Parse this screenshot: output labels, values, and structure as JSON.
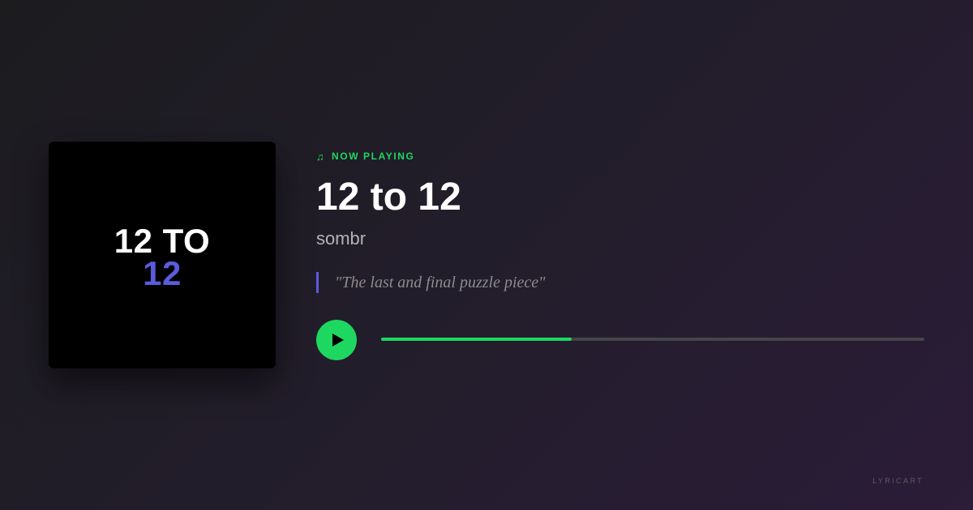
{
  "album_art": {
    "line1": "12 TO",
    "line2": "12",
    "line2_color": "#5b5bdc"
  },
  "now_playing": {
    "icon": "music-note-icon",
    "label": "NOW PLAYING",
    "color": "#1ed760"
  },
  "track": {
    "title": "12 to 12",
    "artist": "sombr"
  },
  "lyric": {
    "quote": "\"The last and final puzzle piece\"",
    "accent_color": "#5b5bdc"
  },
  "player": {
    "play_icon": "play-icon",
    "progress": 0.35,
    "accent_color": "#1ed760"
  },
  "brand": {
    "name": "LYRICART"
  }
}
